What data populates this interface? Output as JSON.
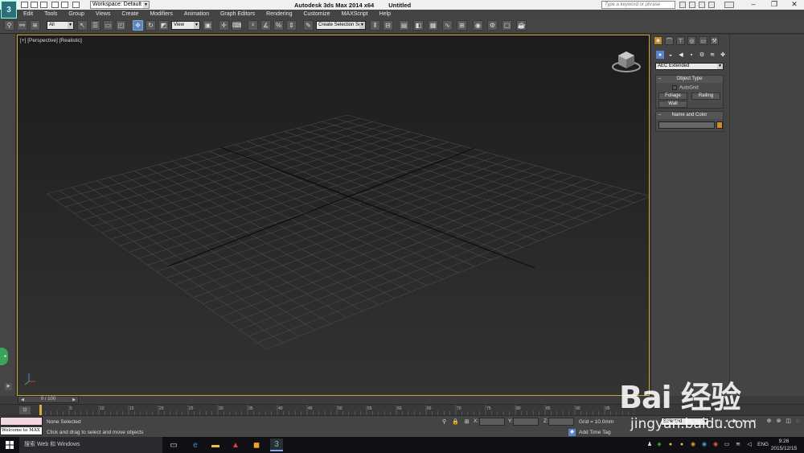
{
  "window": {
    "title": "Autodesk 3ds Max  2014 x64",
    "document": "Untitled",
    "workspace": "Workspace: Default",
    "help_search_placeholder": "Type a keyword or phrase"
  },
  "menu": [
    "Edit",
    "Tools",
    "Group",
    "Views",
    "Create",
    "Modifiers",
    "Animation",
    "Graph Editors",
    "Rendering",
    "Customize",
    "MAXScript",
    "Help"
  ],
  "toolbar": {
    "selection_filter": "All",
    "reference_coord": "View",
    "named_selection": "Create Selection Se"
  },
  "viewport": {
    "label": "[+] [Perspective] [Realistic]"
  },
  "command_panel": {
    "category": "AEC Extended",
    "object_type": {
      "title": "Object Type",
      "autogrid": "AutoGrid",
      "buttons": [
        "Foliage",
        "Railing",
        "Wall"
      ]
    },
    "name_color": {
      "title": "Name and Color",
      "swatch_color": "#d08a2a"
    }
  },
  "timeline": {
    "slider_label": "0 / 100",
    "ticks": [
      5,
      10,
      15,
      20,
      25,
      30,
      35,
      40,
      45,
      50,
      55,
      60,
      65,
      70,
      75,
      80,
      85,
      90,
      95
    ]
  },
  "status": {
    "selection": "None Selected",
    "prompt": "Click and drag to select and move objects",
    "coords": {
      "x": "X:",
      "y": "Y:",
      "z": "Z:"
    },
    "grid": "Grid = 10.0mm",
    "add_time_tag": "Add Time Tag",
    "key_filter": "Selected",
    "maxscript_welcome": "Welcome to MAX"
  },
  "taskbar": {
    "search_placeholder": "搜索 Web 和 Windows",
    "lang": "ENG",
    "time": "9:26",
    "date": "2015/12/15"
  },
  "watermark": {
    "brand": "Bai 经验",
    "url": "jingyan.baidu.com"
  },
  "colors": {
    "accent_blue": "#5a84c8",
    "viewport_border": "#c8a030",
    "panel_bg": "#444444"
  }
}
